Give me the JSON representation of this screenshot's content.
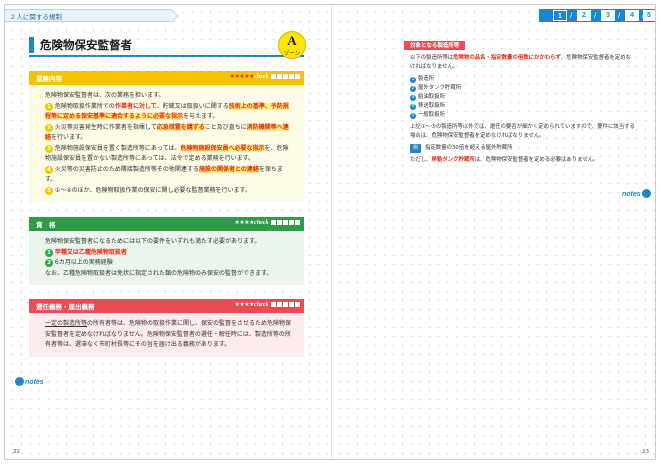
{
  "header": {
    "section": "2 人に関する規制",
    "tabs": [
      "1",
      "2",
      "3",
      "4",
      "5"
    ],
    "active_tab": "1"
  },
  "title": {
    "text": "危険物保安監督者",
    "zone_letter": "A",
    "zone_label": "ゾーン"
  },
  "box1": {
    "heading": "業務内容",
    "stars": "★★★★★",
    "check": "check",
    "intro": "危険物保安監督者は、次の業務を担います。",
    "items": [
      {
        "num": "1",
        "pre": "危険物取扱作業所での",
        "red1": "作業者に対して",
        "mid": "、貯蔵又は取扱いに関する",
        "red2": "技術上の基準、予防規程等に定める保安基準に適合するように必要な指示",
        "post": "を与えます。"
      },
      {
        "num": "2",
        "pre": "火災等災害発生時に作業者を指揮して",
        "red1": "応急措置を講ずる",
        "mid": "こと及び直ちに",
        "red2": "消防機関等へ連絡",
        "post": "を行います。"
      },
      {
        "num": "3",
        "pre": "危険物施設保安員を置く製造所等にあっては、",
        "red1": "危険物施設保安員へ必要な指示",
        "mid": "を、危険物施設保安員を置かない製造所等にあっては、法令で定める業務を行います。",
        "red2": "",
        "post": ""
      },
      {
        "num": "4",
        "pre": "火災等の災害防止のため隣接製造所等その他関連する",
        "red1": "施設の関係者との連絡",
        "mid": "を保ちます。",
        "red2": "",
        "post": ""
      },
      {
        "num": "5",
        "pre": "①～④のほか、危険物取扱作業の保安に関し必要な監督業務を行います。",
        "red1": "",
        "mid": "",
        "red2": "",
        "post": ""
      }
    ]
  },
  "box2": {
    "heading": "資　格",
    "stars": "★★★★",
    "check": "check",
    "intro": "危険物保安監督者になるためには以下の要件をいずれも満たす必要があります。",
    "items": [
      {
        "num": "1",
        "text": "甲種又は乙種危険物取扱者"
      },
      {
        "num": "2",
        "text": "6カ月以上の実務経験"
      }
    ],
    "note": "なお、乙種危険物取扱者は免状に指定された類の危険物のみ保安の監督ができます。"
  },
  "box3": {
    "heading": "選任義務・届出義務",
    "stars": "★★★★",
    "check": "check",
    "body_pre": "一定の製造所等",
    "body_rest": "の所有者等は、危険物の取扱作業に関し、保安の監督をさせるため危険物保安監督者を定めなければなりません。危険物保安監督者の選任・解任時には、製造所等の所有者等は、遅滞なく市町村長等にその旨を届け出る義務があります。"
  },
  "left_page": {
    "notes_label": "notes",
    "page_number": "22"
  },
  "right_page": {
    "card_tag": "対象となる製造所等",
    "lead_pre": "以下の製造所等は",
    "lead_red": "危険物の品名・指定数量の倍数にかかわらず",
    "lead_post": "、危険物保安監督者を定めなければなりません。",
    "list": [
      {
        "num": "1",
        "text": "製造所"
      },
      {
        "num": "2",
        "text": "屋外タンク貯蔵所"
      },
      {
        "num": "3",
        "text": "給油取扱所"
      },
      {
        "num": "4",
        "text": "移送取扱所"
      },
      {
        "num": "5",
        "text": "一般取扱所"
      }
    ],
    "follow": "上記①～⑤の製造所等以外では、選任の要否が細かく定められていますので、要件に該当する場合は、危険物保安監督者を定めなければなりません。",
    "example_tag": "例",
    "example_text": "指定数量の30倍を超える屋外貯蔵所",
    "exception_pre": "ただし、",
    "exception_red": "移動タンク貯蔵所",
    "exception_post": "は、危険物保安監督者を定める必要はありません。",
    "notes_label": "notes",
    "page_number": "23"
  }
}
